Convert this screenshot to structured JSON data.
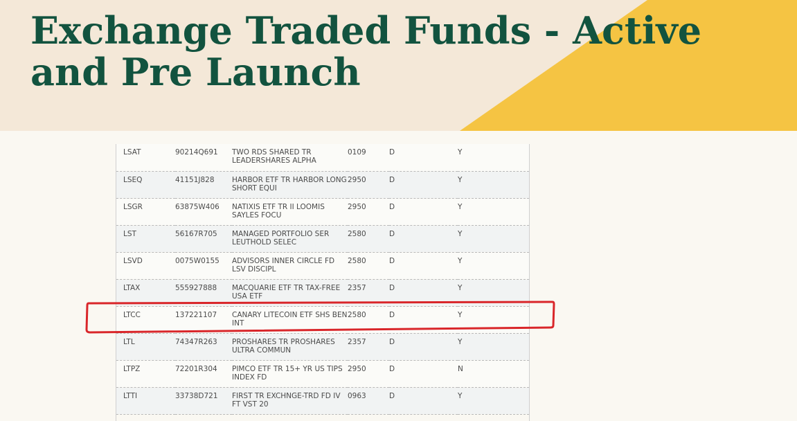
{
  "header": {
    "title": "Exchange Traded Funds - Active and Pre Launch",
    "colors": {
      "background": "#f4e8d8",
      "accent": "#f5c443",
      "title": "#12533f"
    }
  },
  "table": {
    "rows": [
      {
        "symbol": "LSAT",
        "cusip": "90214Q691",
        "name": "TWO RDS SHARED TR LEADERSHARES ALPHA",
        "code": "0109",
        "type": "D",
        "flag": "Y"
      },
      {
        "symbol": "LSEQ",
        "cusip": "41151J828",
        "name": "HARBOR ETF TR HARBOR LONG SHORT EQUI",
        "code": "2950",
        "type": "D",
        "flag": "Y"
      },
      {
        "symbol": "LSGR",
        "cusip": "63875W406",
        "name": "NATIXIS ETF TR II LOOMIS SAYLES FOCU",
        "code": "2950",
        "type": "D",
        "flag": "Y"
      },
      {
        "symbol": "LST",
        "cusip": "56167R705",
        "name": "MANAGED PORTFOLIO SER LEUTHOLD SELEC",
        "code": "2580",
        "type": "D",
        "flag": "Y"
      },
      {
        "symbol": "LSVD",
        "cusip": "0075W0155",
        "name": "ADVISORS INNER CIRCLE FD LSV DISCIPL",
        "code": "2580",
        "type": "D",
        "flag": "Y"
      },
      {
        "symbol": "LTAX",
        "cusip": "555927888",
        "name": "MACQUARIE ETF TR TAX-FREE USA ETF",
        "code": "2357",
        "type": "D",
        "flag": "Y"
      },
      {
        "symbol": "LTCC",
        "cusip": "137221107",
        "name": "CANARY LITECOIN ETF SHS BEN INT",
        "code": "2580",
        "type": "D",
        "flag": "Y"
      },
      {
        "symbol": "LTL",
        "cusip": "74347R263",
        "name": "PROSHARES TR PROSHARES ULTRA COMMUN",
        "code": "2357",
        "type": "D",
        "flag": "Y"
      },
      {
        "symbol": "LTPZ",
        "cusip": "72201R304",
        "name": "PIMCO ETF TR 15+ YR US TIPS INDEX FD",
        "code": "2950",
        "type": "D",
        "flag": "N"
      },
      {
        "symbol": "LTTI",
        "cusip": "33738D721",
        "name": "FIRST TR EXCHNGE-TRD FD IV FT VST 20",
        "code": "0963",
        "type": "D",
        "flag": "Y"
      }
    ],
    "highlighted_symbol": "LTCC",
    "highlight_color": "#d9262a"
  }
}
